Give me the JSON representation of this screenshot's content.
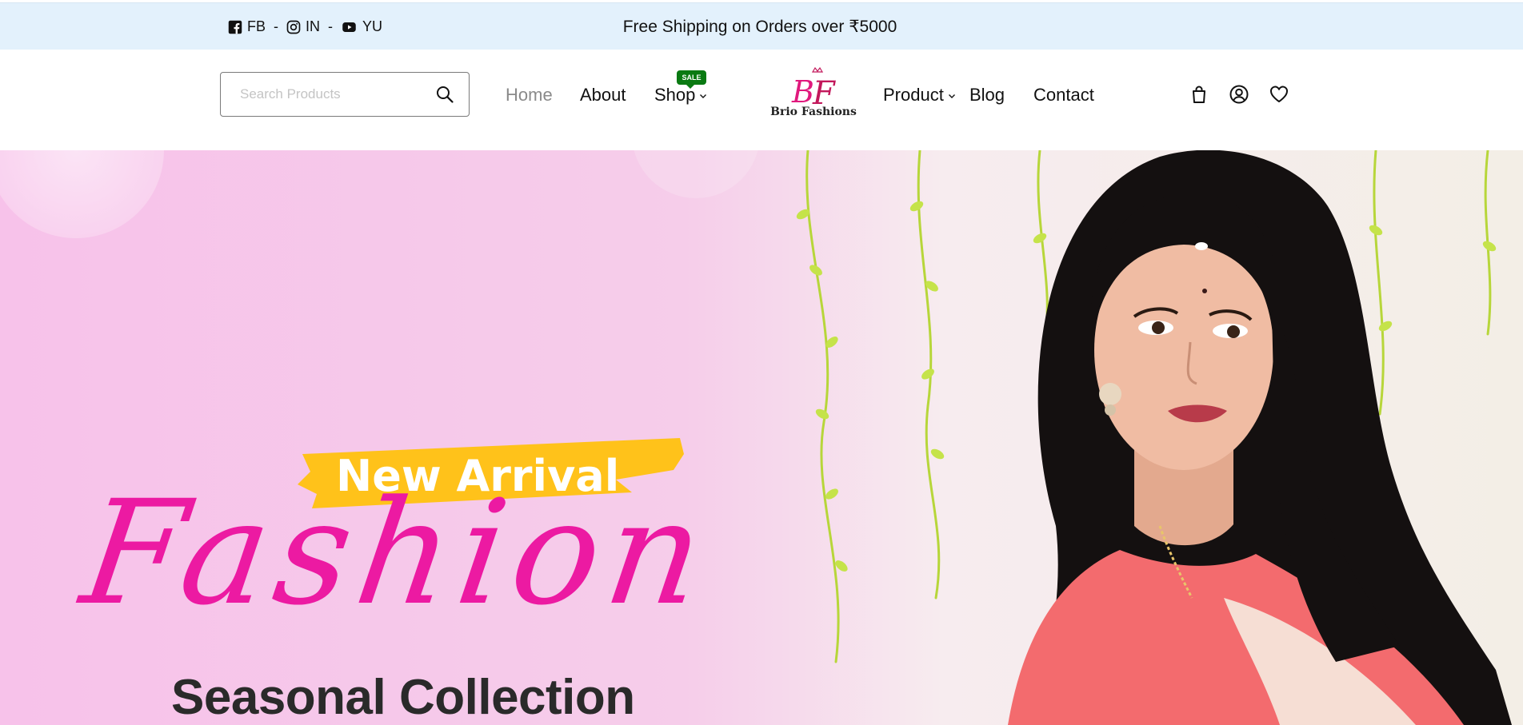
{
  "topbar": {
    "socials": [
      {
        "icon": "facebook-icon",
        "label": "FB",
        "sep": "-"
      },
      {
        "icon": "instagram-icon",
        "label": "IN",
        "sep": "-"
      },
      {
        "icon": "youtube-icon",
        "label": "YU",
        "sep": ""
      }
    ],
    "announcement": "Free Shipping on Orders over ₹5000"
  },
  "header": {
    "search": {
      "placeholder": "Search Products",
      "value": ""
    },
    "nav_left": [
      {
        "label": "Home",
        "active": true
      },
      {
        "label": "About"
      },
      {
        "label": "Shop",
        "dropdown": true,
        "badge": "SALE"
      }
    ],
    "logo": {
      "mark": "BF",
      "name": "Brio Fashions"
    },
    "nav_right": [
      {
        "label": "Product",
        "dropdown": true
      },
      {
        "label": "Blog"
      },
      {
        "label": "Contact"
      }
    ],
    "icons": [
      "bag-icon",
      "account-icon",
      "heart-icon"
    ]
  },
  "hero": {
    "tag": "New Arrival",
    "headline": "Fashion",
    "subheadline": "Seasonal Collection"
  },
  "colors": {
    "topbar_bg": "#e3f1fc",
    "accent_pink": "#ec1aa2",
    "tag_yellow": "#ffc21a",
    "sale_green": "#0a7a12",
    "hero_bg": "#f6c8ea"
  }
}
